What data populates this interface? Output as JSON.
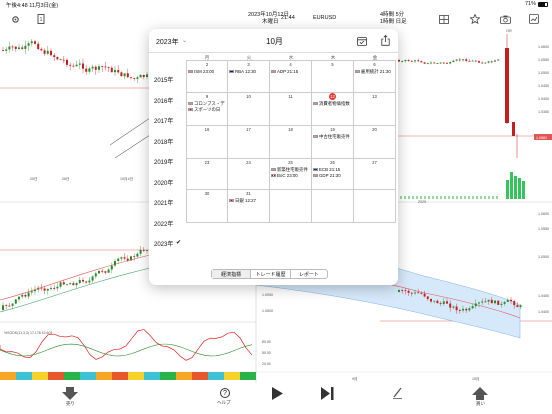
{
  "status": {
    "time_date": "午後4:48 11月3日(金)",
    "battery": "71%"
  },
  "toolbar": {
    "datetime_line1": "2023年10月12日",
    "datetime_line2": "木曜日",
    "time": "21:44",
    "symbol": "EURUSD",
    "timeframe_line1": "4時間 5分",
    "timeframe_line2": "1時間 日足"
  },
  "calendar": {
    "year_button": "2023年",
    "month_title": "10月",
    "weekdays": [
      "月",
      "火",
      "水",
      "木",
      "金"
    ],
    "years": [
      "2015年",
      "2016年",
      "2017年",
      "2018年",
      "2019年",
      "2020年",
      "2021年",
      "2022年",
      "2023年"
    ],
    "selected_year_check": "✔",
    "days": [
      [
        "",
        "",
        "",
        "",
        ""
      ],
      [
        {
          "day": "2",
          "events": [
            {
              "flag": "us",
              "text": "ISM 23:00"
            }
          ]
        },
        {
          "day": "3",
          "events": [
            {
              "flag": "au",
              "text": "RBA 12:30"
            }
          ]
        },
        {
          "day": "4",
          "events": [
            {
              "flag": "us",
              "text": "ADP 21:15"
            }
          ]
        },
        {
          "day": "5",
          "events": []
        },
        {
          "day": "6",
          "events": [
            {
              "flag": "us",
              "text": "雇用統計 21:30"
            }
          ]
        }
      ],
      [
        {
          "day": "9",
          "events": [
            {
              "flag": "us",
              "text": "コロンブス・デ"
            },
            {
              "flag": "jp",
              "text": "スポーツの日"
            }
          ]
        },
        {
          "day": "10",
          "events": []
        },
        {
          "day": "11",
          "events": []
        },
        {
          "day": "12",
          "today": true,
          "events": [
            {
              "flag": "us",
              "text": "消費者物価指数"
            }
          ]
        },
        {
          "day": "13",
          "events": []
        }
      ],
      [
        {
          "day": "16",
          "events": []
        },
        {
          "day": "17",
          "events": []
        },
        {
          "day": "18",
          "events": []
        },
        {
          "day": "19",
          "events": [
            {
              "flag": "us",
              "text": "中古住宅販売件"
            }
          ]
        },
        {
          "day": "20",
          "events": []
        }
      ],
      [
        {
          "day": "23",
          "events": []
        },
        {
          "day": "24",
          "events": []
        },
        {
          "day": "25",
          "events": [
            {
              "flag": "us",
              "text": "新築住宅販売件"
            },
            {
              "flag": "ca",
              "text": "BoC 23:00"
            }
          ]
        },
        {
          "day": "26",
          "events": [
            {
              "flag": "eu",
              "text": "ECB 21:15"
            },
            {
              "flag": "us",
              "text": "GDP 21:30"
            }
          ]
        },
        {
          "day": "27",
          "events": []
        }
      ],
      [
        {
          "day": "30",
          "events": []
        },
        {
          "day": "31",
          "events": [
            {
              "flag": "jp",
              "text": "日銀 12:27"
            }
          ]
        },
        {
          "day": "",
          "events": []
        },
        {
          "day": "",
          "events": []
        },
        {
          "day": "",
          "events": []
        }
      ]
    ],
    "tabs": [
      "経済指標",
      "トレード履歴",
      "レポート"
    ]
  },
  "chart": {
    "price_labels": [
      "1.0600",
      "1.0550",
      "1.0500",
      "1.0450",
      "1.0400",
      "1.0350",
      "1.0600",
      "1.0550",
      "1.0500",
      "1.0450",
      "1.0400",
      "1.0050",
      "1.0500"
    ],
    "current_price": "1.0581",
    "x_labels_top": [
      "20日",
      "26日",
      "10月4日"
    ],
    "x_labels_right_top": [
      "2025"
    ],
    "x_labels_bottom_right": [
      "9月",
      "10月"
    ],
    "oscillator_label": "%SOOK(11,3,3) 17.178 42.603",
    "osc_levels": [
      "80.00",
      "50.00",
      "20.00"
    ],
    "right_top_label": "OR"
  },
  "bottom": {
    "sell_label": "売り",
    "help_label": "ヘルプ",
    "buy_label": "買い"
  },
  "colors": {
    "up": "#2a8a2a",
    "down": "#c21f1f",
    "accent": "#1e6fd9"
  }
}
